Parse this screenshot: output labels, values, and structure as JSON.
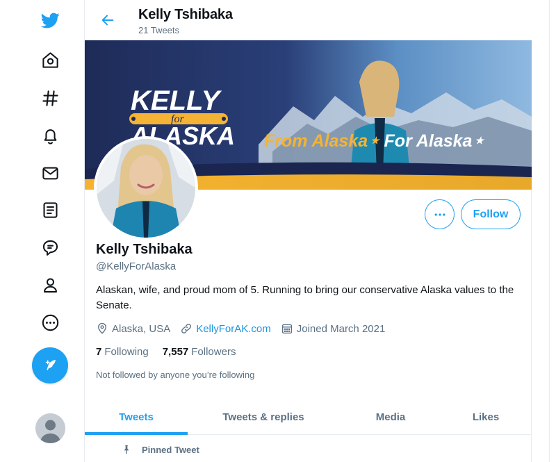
{
  "header": {
    "name": "Kelly Tshibaka",
    "tweet_count": "21 Tweets"
  },
  "banner": {
    "logo_top": "KELLY",
    "logo_for": "for",
    "logo_bottom": "ALASKA",
    "tagline_part1": "From Alaska",
    "tagline_part2": "For Alaska"
  },
  "profile": {
    "name": "Kelly Tshibaka",
    "handle": "@KellyForAlaska",
    "bio": "Alaskan, wife, and proud mom of 5. Running to bring our conservative Alaska values to the Senate.",
    "location": "Alaska, USA",
    "website": "KellyForAK.com",
    "joined": "Joined March 2021",
    "following_count": "7",
    "following_label": "Following",
    "followers_count": "7,557",
    "followers_label": "Followers",
    "not_followed_text": "Not followed by anyone you’re following",
    "follow_button": "Follow",
    "more_button": "•••"
  },
  "tabs": [
    {
      "label": "Tweets",
      "active": true
    },
    {
      "label": "Tweets & replies",
      "active": false
    },
    {
      "label": "Media",
      "active": false
    },
    {
      "label": "Likes",
      "active": false
    }
  ],
  "pinned_label": "Pinned Tweet",
  "sidebar": {
    "icons": [
      "twitter-logo-icon",
      "home-icon",
      "explore-hashtag-icon",
      "notifications-bell-icon",
      "messages-envelope-icon",
      "lists-icon",
      "topics-icon",
      "profile-icon",
      "more-icon",
      "compose-tweet-icon"
    ]
  },
  "colors": {
    "accent": "#1da1f2",
    "link": "#1b95e0",
    "muted_text": "#5b7083",
    "banner_navy": "#1f2d5c",
    "banner_gold": "#f2b134"
  }
}
